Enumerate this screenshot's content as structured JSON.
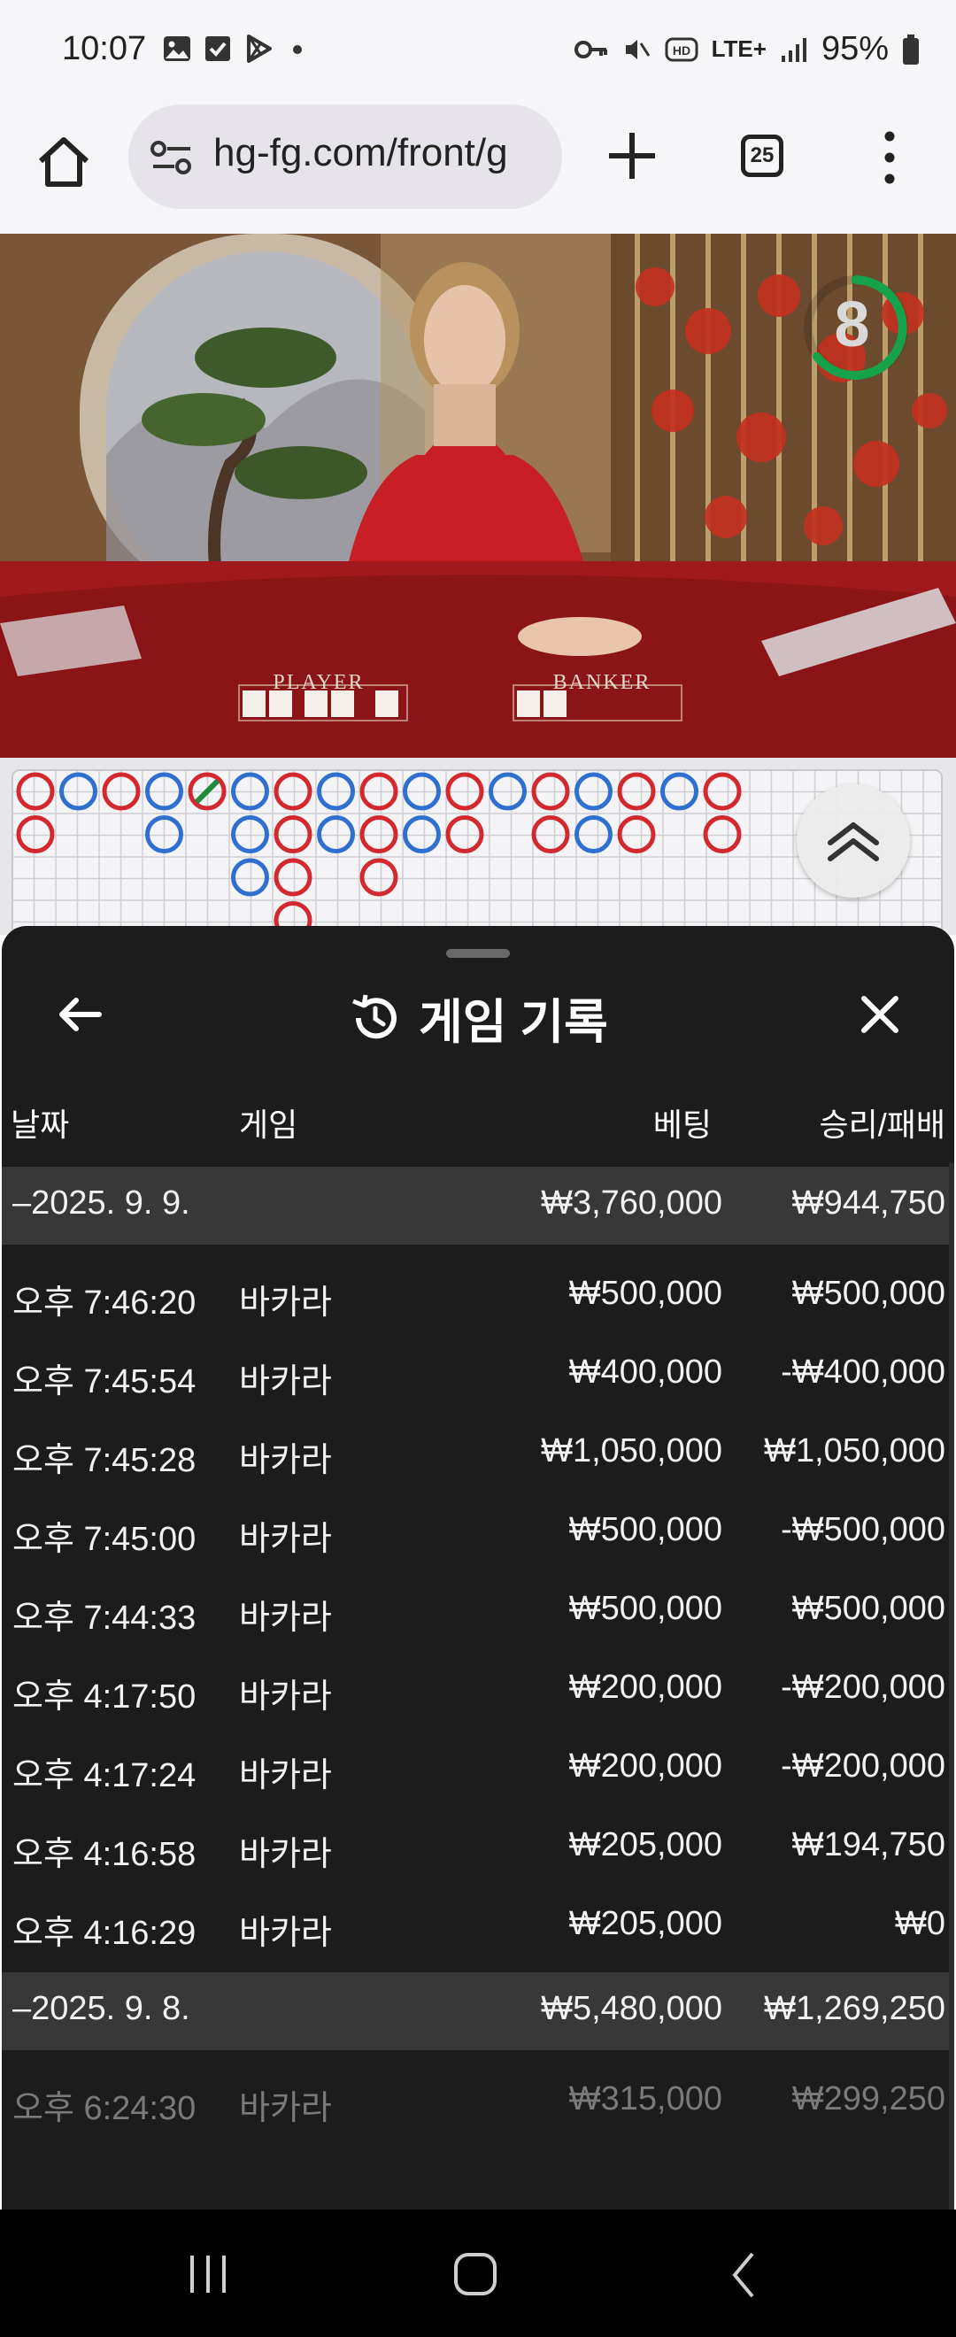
{
  "status_bar": {
    "time": "10:07",
    "network": "LTE+",
    "battery": "95%",
    "left_icons": [
      "image-icon",
      "checkbox-icon",
      "play-store-icon",
      "dot-icon"
    ],
    "right_icons": [
      "key-icon",
      "mute-icon",
      "hd-icon",
      "signal-icon",
      "battery-icon"
    ]
  },
  "browser": {
    "url": "hg-fg.com/front/g",
    "tab_count": "25"
  },
  "video": {
    "countdown": "8",
    "table_labels": {
      "player": "PLAYER",
      "banker": "BANKER"
    }
  },
  "roadmap": {
    "colors": {
      "banker": "#d3292e",
      "player": "#2f6fcf",
      "tie": "#1e8a3c"
    }
  },
  "history": {
    "title": "게임 기록",
    "columns": {
      "date": "날짜",
      "game": "게임",
      "bet": "베팅",
      "win_loss": "승리/패배"
    },
    "groups": [
      {
        "date": "–2025. 9. 9.",
        "bet_total": "₩3,760,000",
        "wl_total": "₩944,750",
        "rows": [
          {
            "time": "오후 7:46:20",
            "game": "바카라",
            "bet": "₩500,000",
            "wl": "₩500,000"
          },
          {
            "time": "오후 7:45:54",
            "game": "바카라",
            "bet": "₩400,000",
            "wl": "-₩400,000"
          },
          {
            "time": "오후 7:45:28",
            "game": "바카라",
            "bet": "₩1,050,000",
            "wl": "₩1,050,000"
          },
          {
            "time": "오후 7:45:00",
            "game": "바카라",
            "bet": "₩500,000",
            "wl": "-₩500,000"
          },
          {
            "time": "오후 7:44:33",
            "game": "바카라",
            "bet": "₩500,000",
            "wl": "₩500,000"
          },
          {
            "time": "오후 4:17:50",
            "game": "바카라",
            "bet": "₩200,000",
            "wl": "-₩200,000"
          },
          {
            "time": "오후 4:17:24",
            "game": "바카라",
            "bet": "₩200,000",
            "wl": "-₩200,000"
          },
          {
            "time": "오후 4:16:58",
            "game": "바카라",
            "bet": "₩205,000",
            "wl": "₩194,750"
          },
          {
            "time": "오후 4:16:29",
            "game": "바카라",
            "bet": "₩205,000",
            "wl": "₩0"
          }
        ]
      },
      {
        "date": "–2025. 9. 8.",
        "bet_total": "₩5,480,000",
        "wl_total": "₩1,269,250",
        "rows": [
          {
            "time": "오후 6:24:30",
            "game": "바카라",
            "bet": "₩315,000",
            "wl": "₩299,250"
          }
        ]
      }
    ]
  }
}
